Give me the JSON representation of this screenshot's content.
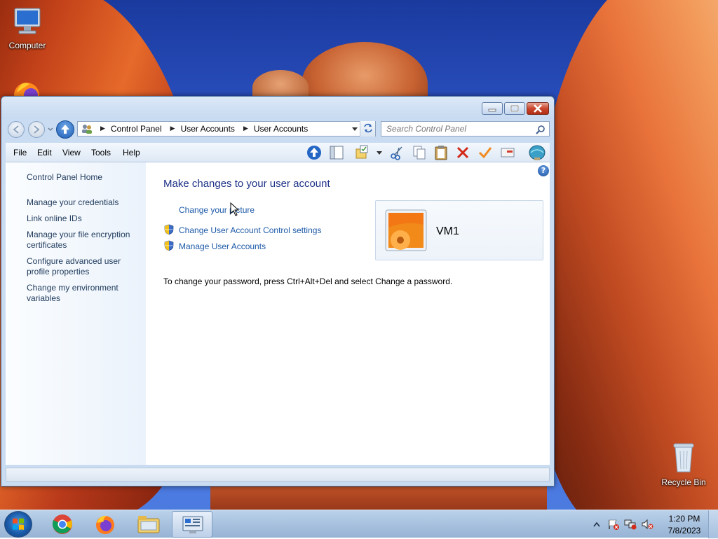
{
  "desktop": {
    "icons": [
      {
        "label": "Computer",
        "icon": "computer-icon"
      },
      {
        "label": "Recycle Bin",
        "icon": "recycle-bin-icon"
      }
    ]
  },
  "window": {
    "address": {
      "crumbs": [
        "Control Panel",
        "User Accounts",
        "User Accounts"
      ]
    },
    "search": {
      "placeholder": "Search Control Panel"
    },
    "menu": [
      "File",
      "Edit",
      "View",
      "Tools",
      "Help"
    ],
    "left_pane": {
      "home": "Control Panel Home",
      "links": [
        "Manage your credentials",
        "Link online IDs",
        "Manage your file encryption certificates",
        "Configure advanced user profile properties",
        "Change my environment variables"
      ]
    },
    "main": {
      "heading": "Make changes to your user account",
      "tasks": [
        {
          "label": "Change your picture",
          "shield": false
        },
        {
          "label": "Change User Account Control settings",
          "shield": true
        },
        {
          "label": "Manage User Accounts",
          "shield": true
        }
      ],
      "password_note": "To change your password, press Ctrl+Alt+Del and select Change a password.",
      "account": {
        "name": "VM1"
      }
    }
  },
  "taskbar": {
    "apps": [
      "chrome-icon",
      "firefox-icon",
      "file-explorer-icon",
      "control-panel-icon"
    ],
    "clock": {
      "time": "1:20 PM",
      "date": "7/8/2023"
    }
  }
}
